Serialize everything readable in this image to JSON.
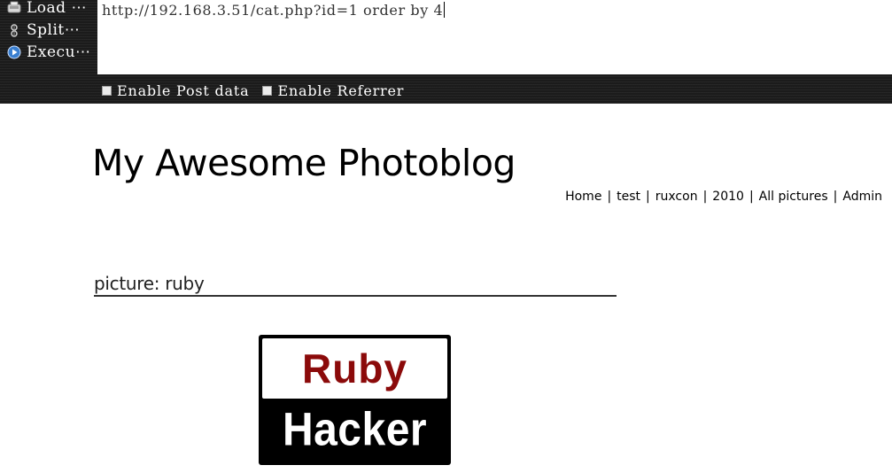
{
  "hackbar": {
    "menu": [
      {
        "label": "Load ⋯",
        "icon": "load-url-icon"
      },
      {
        "label": "Split⋯",
        "icon": "split-url-icon"
      },
      {
        "label": "Execu⋯",
        "icon": "execute-icon"
      }
    ],
    "url_value": "http://192.168.3.51/cat.php?id=1 order by 4",
    "checkboxes": [
      {
        "label": "Enable Post data",
        "checked": false
      },
      {
        "label": "Enable Referrer",
        "checked": false
      }
    ]
  },
  "site": {
    "title": "My Awesome Photoblog",
    "nav": [
      "Home",
      "test",
      "ruxcon",
      "2010",
      "All pictures",
      "Admin"
    ],
    "nav_separator": "|"
  },
  "picture": {
    "heading": "picture: ruby",
    "image_text_top": "Ruby",
    "image_text_bottom": "Hacker"
  },
  "colors": {
    "ruby_text": "#8b0a0a",
    "toolbar_bg": "#1b1b1b"
  }
}
